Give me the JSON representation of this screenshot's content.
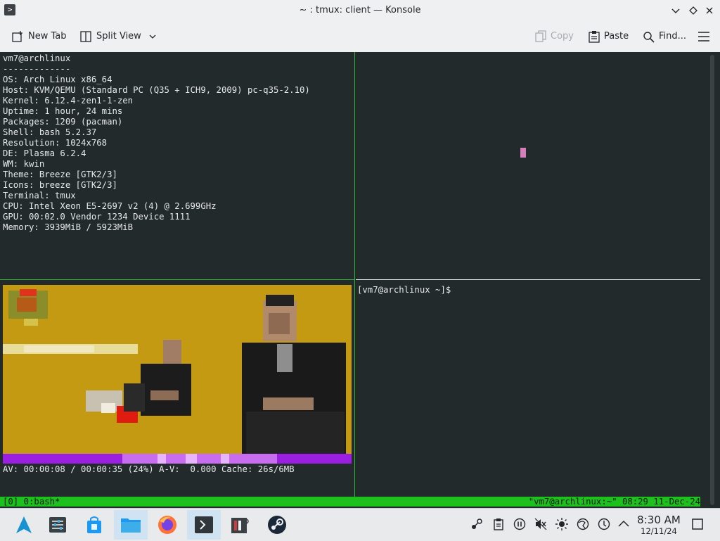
{
  "window": {
    "title": "~ : tmux: client — Konsole",
    "app_icon": "konsole-icon"
  },
  "toolbar": {
    "new_tab": "New Tab",
    "split_view": "Split View",
    "copy": "Copy",
    "paste": "Paste",
    "find": "Find..."
  },
  "terminal": {
    "neofetch_lines": [
      "vm7@archlinux",
      "-------------",
      "OS: Arch Linux x86_64",
      "Host: KVM/QEMU (Standard PC (Q35 + ICH9, 2009) pc-q35-2.10)",
      "Kernel: 6.12.4-zen1-1-zen",
      "Uptime: 1 hour, 24 mins",
      "Packages: 1209 (pacman)",
      "Shell: bash 5.2.37",
      "Resolution: 1024x768",
      "DE: Plasma 6.2.4",
      "WM: kwin",
      "Theme: Breeze [GTK2/3]",
      "Icons: breeze [GTK2/3]",
      "Terminal: tmux",
      "CPU: Intel Xeon E5-2697 v2 (4) @ 2.699GHz",
      "GPU: 00:02.0 Vendor 1234 Device 1111",
      "Memory: 3939MiB / 5923MiB"
    ],
    "prompt": "[vm7@archlinux ~]$",
    "player_status": "AV: 00:00:08 / 00:00:35 (24%) A-V:  0.000 Cache: 26s/6MB",
    "tmux_left": "[0] 0:bash*",
    "tmux_right": "\"vm7@archlinux:~\" 08:29 11-Dec-24"
  },
  "taskbar": {
    "apps": [
      "application-launcher-icon",
      "system-settings-icon",
      "discover-store-icon",
      "dolphin-files-icon",
      "firefox-icon",
      "konsole-icon",
      "media-player-icon",
      "steam-icon"
    ],
    "tray": [
      "kde-connect-icon",
      "clipboard-icon",
      "media-pause-icon",
      "volume-muted-icon",
      "brightness-icon",
      "network-icon",
      "updates-icon",
      "show-hidden-arrow-icon"
    ],
    "time": "8:30 AM",
    "date": "12/11/24"
  },
  "colors": {
    "tmux_status": "#1ec01e",
    "pane_border": "#2fb52f",
    "terminal_bg": "#232a2c",
    "cursor": "#d57fbd"
  }
}
